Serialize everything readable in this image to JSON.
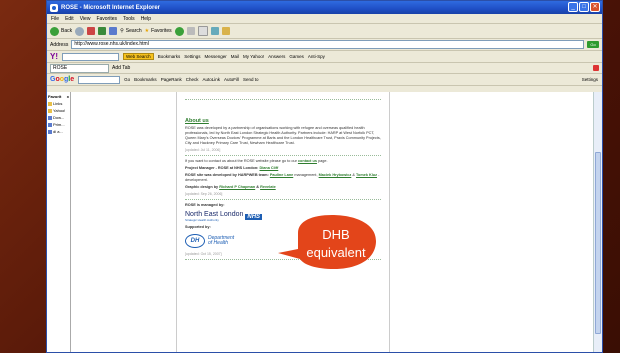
{
  "window": {
    "title": "ROSE - Microsoft Internet Explorer",
    "controls": [
      "_",
      "□",
      "✕"
    ]
  },
  "menu": [
    "File",
    "Edit",
    "View",
    "Favorites",
    "Tools",
    "Help"
  ],
  "toolbar": {
    "back": "Back",
    "search": "Search",
    "favorites": "Favorites"
  },
  "address": {
    "label": "Address",
    "url": "http://www.rose.nhs.uk/index.html",
    "go": "Go"
  },
  "yahoo_bar": {
    "logo": "Y!",
    "web_search": "Web Search",
    "items": [
      "Bookmarks",
      "Settings",
      "Messenger",
      "Mail",
      "My Yahoo!",
      "Answers",
      "Games",
      "Anti-Spy"
    ]
  },
  "tab": {
    "label": "ROSE",
    "add": "Add Tab"
  },
  "google_bar": {
    "logo": "Google",
    "go": "Go",
    "items": [
      "Bookmarks",
      "PageRank",
      "Check",
      "AutoLink",
      "AutoFill",
      "Send to"
    ],
    "settings": "Settings"
  },
  "favorites": {
    "title": "Favorit",
    "items": [
      "Links",
      "Yahoo!",
      "Dow...",
      "Prim...",
      "di a..."
    ]
  },
  "page": {
    "about_heading": "About us",
    "about_text": "ROSE was developed by a partnership of organisations working with refugee and overseas qualified health professionals, led by North East London Strategic Health Authority. Partners include: HARP at West Norfolk PCT, Queen Mary's Overseas Doctors' Programme at Barts and the London Healthcare Trust, Praxis Community Projects, City and Hackney Primary Care Trust, Newham Healthcare Trust.",
    "about_date": "[updated: Jul 11, 2006]",
    "contact_pre": "If you want to contact us about the ROSE website please go to our",
    "contact_link": "contact us",
    "contact_post": "page.",
    "pm_label": "Project Manager - ROSE at NHS London:",
    "pm_name": "Diana Cliff",
    "dev_pre": "ROSE site was developed by HARPWEB team:",
    "dev_name1": "Pauline Lane",
    "dev_mid": "management,",
    "dev_name2": "Maciek Hrybowicz",
    "dev_and": "&",
    "dev_name3": "Tomek Kluz",
    "dev_post": "- development.",
    "graphic_label": "Graphic design by",
    "graphic_name1": "Richard P Chapman",
    "graphic_and": "&",
    "graphic_name2": "Revelate",
    "graphic_date": "[updated: Sep 26, 2006]",
    "managed_label": "ROSE is managed by:",
    "nel_text": "North East London",
    "nel_badge": "NHS",
    "nel_sub": "Strategic Health Authority",
    "supported_label": "Supported by:",
    "dh_logo": "DH",
    "dh_text1": "Department",
    "dh_text2": "of Health",
    "last_date": "[updated: Oct 15, 2007]"
  },
  "callout": {
    "line1": "DHB",
    "line2": "equivalent",
    "color": "#e3451a"
  }
}
